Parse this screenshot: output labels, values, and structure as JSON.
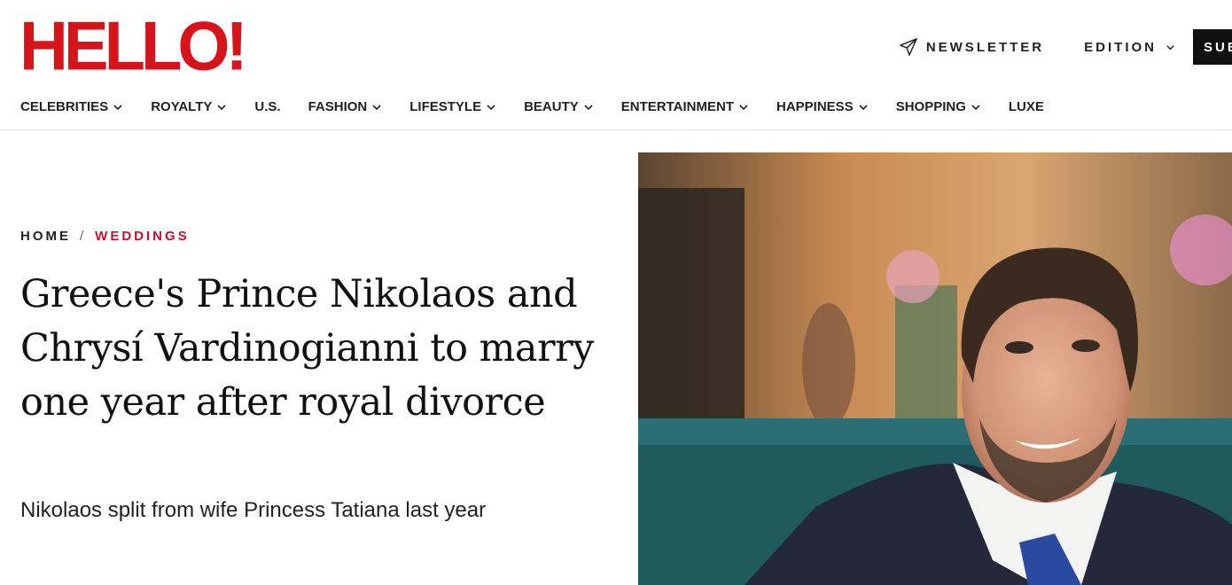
{
  "header": {
    "logo_text": "HELLO!",
    "newsletter_label": "NEWSLETTER",
    "edition_label": "EDITION",
    "subscribe_label": "SUBSCRIBE"
  },
  "nav": {
    "items": [
      {
        "label": "CELEBRITIES",
        "has_dropdown": true
      },
      {
        "label": "ROYALTY",
        "has_dropdown": true
      },
      {
        "label": "U.S.",
        "has_dropdown": false
      },
      {
        "label": "FASHION",
        "has_dropdown": true
      },
      {
        "label": "LIFESTYLE",
        "has_dropdown": true
      },
      {
        "label": "BEAUTY",
        "has_dropdown": true
      },
      {
        "label": "ENTERTAINMENT",
        "has_dropdown": true
      },
      {
        "label": "HAPPINESS",
        "has_dropdown": true
      },
      {
        "label": "SHOPPING",
        "has_dropdown": true
      },
      {
        "label": "LUXE",
        "has_dropdown": false
      }
    ]
  },
  "article": {
    "breadcrumb": {
      "home": "HOME",
      "separator": "/",
      "category": "WEDDINGS"
    },
    "headline": "Greece's Prince Nikolaos and Chrysí Vardinogianni to marry one year after royal divorce",
    "subheadline": "Nikolaos split from wife Princess Tatiana last year"
  },
  "colors": {
    "brand_red": "#d7141a",
    "category_red": "#c8102e",
    "text_dark": "#111111",
    "subscribe_bg": "#111111"
  },
  "icons": {
    "newsletter": "paper-plane-icon",
    "dropdown": "chevron-down-icon"
  }
}
